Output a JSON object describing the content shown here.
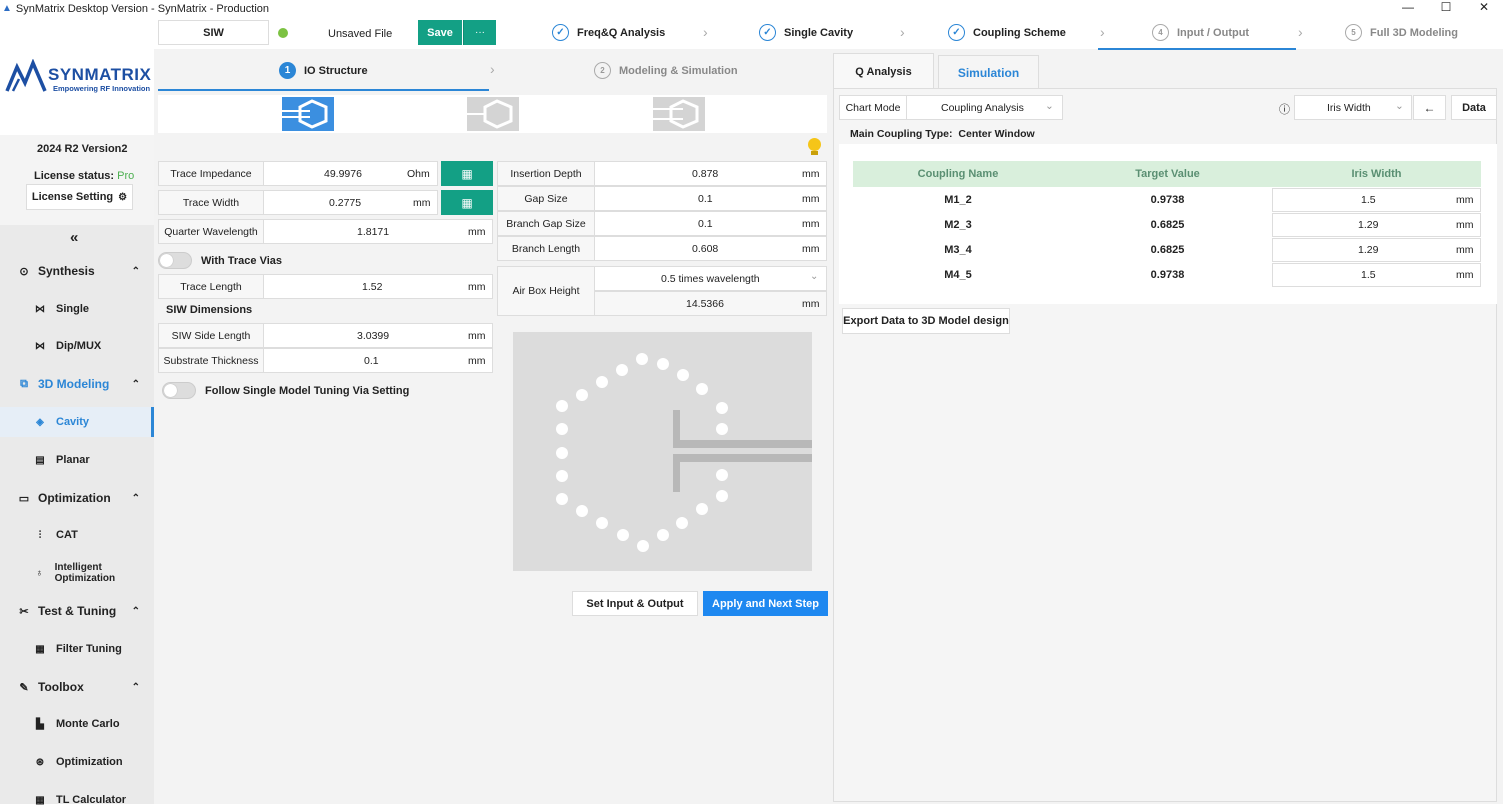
{
  "window": {
    "title": "SynMatrix Desktop Version - SynMatrix - Production",
    "controls": [
      "—",
      "☐",
      "✕"
    ]
  },
  "sidebar": {
    "logo_name": "SYNMATRIX",
    "logo_tagline": "Empowering RF Innovation",
    "version": "2024 R2 Version2",
    "license_label": "License status:",
    "license_value": "Pro",
    "license_button": "License Setting",
    "collapse": "«",
    "sections": [
      {
        "label": "Synthesis",
        "icon": "⊙",
        "items": [
          {
            "label": "Single",
            "icon": "⋈"
          },
          {
            "label": "Dip/MUX",
            "icon": "⋈"
          }
        ]
      },
      {
        "label": "3D Modeling",
        "icon": "⧉",
        "items": [
          {
            "label": "Cavity",
            "icon": "◈"
          },
          {
            "label": "Planar",
            "icon": "▤"
          }
        ]
      },
      {
        "label": "Optimization",
        "icon": "▭",
        "items": [
          {
            "label": "CAT",
            "icon": "⫶"
          },
          {
            "label": "Intelligent Optimization",
            "icon": "♁"
          }
        ]
      },
      {
        "label": "Test & Tuning",
        "icon": "✂",
        "items": [
          {
            "label": "Filter Tuning",
            "icon": "▦"
          }
        ]
      },
      {
        "label": "Toolbox",
        "icon": "✎",
        "items": [
          {
            "label": "Monte Carlo",
            "icon": "▙"
          },
          {
            "label": "Optimization",
            "icon": "⊛"
          },
          {
            "label": "TL Calculator",
            "icon": "▦"
          }
        ]
      }
    ],
    "chevron": "⌃"
  },
  "topbar": {
    "project": "SIW",
    "file_status": "Unsaved File",
    "save": "Save",
    "more": "···",
    "steps": [
      {
        "label": "Freq&Q Analysis",
        "mark": "✓"
      },
      {
        "label": "Single Cavity",
        "mark": "✓"
      },
      {
        "label": "Coupling Scheme",
        "mark": "✓"
      },
      {
        "label": "Input / Output",
        "mark": "4"
      },
      {
        "label": "Full 3D Modeling",
        "mark": "5"
      }
    ]
  },
  "substeps": [
    {
      "num": "1",
      "label": "IO Structure"
    },
    {
      "num": "2",
      "label": "Modeling & Simulation"
    }
  ],
  "form_left": {
    "trace_impedance": {
      "label": "Trace Impedance",
      "value": "49.9976",
      "unit": "Ohm"
    },
    "trace_width": {
      "label": "Trace Width",
      "value": "0.2775",
      "unit": "mm"
    },
    "quarter_wavelength": {
      "label": "Quarter Wavelength",
      "value": "1.8171",
      "unit": "mm"
    },
    "with_trace_vias": "With Trace Vias",
    "trace_length": {
      "label": "Trace Length",
      "value": "1.52",
      "unit": "mm"
    },
    "siw_dimensions": "SIW Dimensions",
    "siw_side_length": {
      "label": "SIW Side Length",
      "value": "3.0399",
      "unit": "mm"
    },
    "substrate_thickness": {
      "label": "Substrate Thickness",
      "value": "0.1",
      "unit": "mm"
    },
    "follow_single": "Follow Single Model Tuning Via Setting"
  },
  "form_mid": {
    "insertion_depth": {
      "label": "Insertion Depth",
      "value": "0.878",
      "unit": "mm"
    },
    "gap_size": {
      "label": "Gap Size",
      "value": "0.1",
      "unit": "mm"
    },
    "branch_gap_size": {
      "label": "Branch Gap Size",
      "value": "0.1",
      "unit": "mm"
    },
    "branch_length": {
      "label": "Branch Length",
      "value": "0.608",
      "unit": "mm"
    },
    "air_box_height": {
      "label": "Air Box Height",
      "option": "0.5 times wavelength",
      "value": "14.5366",
      "unit": "mm"
    }
  },
  "buttons": {
    "set_io": "Set Input & Output",
    "apply_next": "Apply and Next Step"
  },
  "right": {
    "tabs": [
      "Q Analysis",
      "Simulation"
    ],
    "chart_mode_label": "Chart Mode",
    "chart_mode_value": "Coupling Analysis",
    "param_select": "Iris Width",
    "back": "←",
    "data_button": "Data",
    "info": "ⓘ",
    "main_coupling_label": "Main Coupling Type:",
    "main_coupling_value": "Center Window",
    "table": {
      "headers": [
        "Coupling Name",
        "Target Value",
        "Iris Width"
      ],
      "rows": [
        {
          "name": "M1_2",
          "target": "0.9738",
          "iris": "1.5",
          "unit": "mm"
        },
        {
          "name": "M2_3",
          "target": "0.6825",
          "iris": "1.29",
          "unit": "mm"
        },
        {
          "name": "M3_4",
          "target": "0.6825",
          "iris": "1.29",
          "unit": "mm"
        },
        {
          "name": "M4_5",
          "target": "0.9738",
          "iris": "1.5",
          "unit": "mm"
        }
      ]
    },
    "export": "Export Data to 3D Model design"
  },
  "colors": {
    "accent": "#2b86d6",
    "green": "#13a085",
    "header_bg": "#d9efdc"
  }
}
